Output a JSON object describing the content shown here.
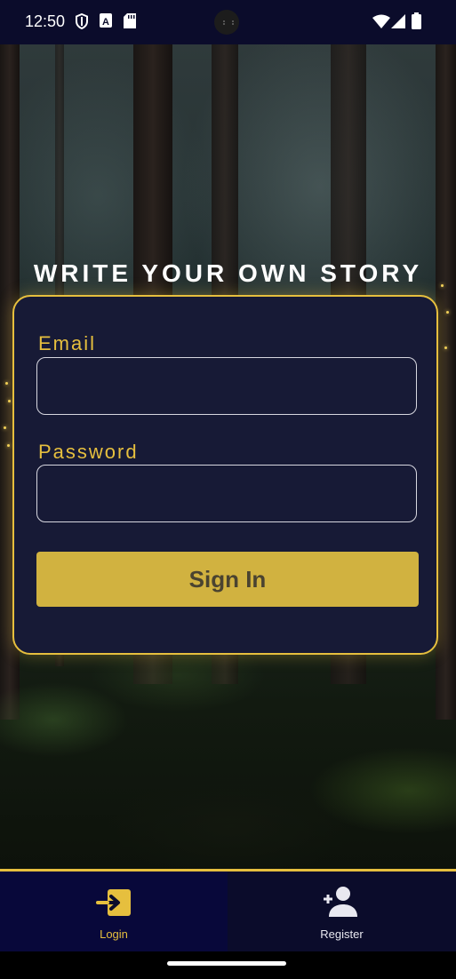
{
  "status_bar": {
    "time": "12:50",
    "left_icons": [
      "shield-icon",
      "a-box-icon",
      "sd-card-icon"
    ],
    "right_icons": [
      "wifi-icon",
      "signal-icon",
      "battery-icon"
    ]
  },
  "headline": "WRITE YOUR OWN STORY",
  "login_form": {
    "email_label": "Email",
    "email_value": "",
    "password_label": "Password",
    "password_value": "",
    "signin_label": "Sign In"
  },
  "bottom_nav": {
    "items": [
      {
        "label": "Login",
        "icon": "login-icon",
        "active": true
      },
      {
        "label": "Register",
        "icon": "add-person-icon",
        "active": false
      }
    ]
  },
  "colors": {
    "accent": "#e6bf3e",
    "card_bg": "#171a36",
    "nav_bg": "#0b0c2b",
    "button_bg": "#d1b240",
    "inactive_nav_text": "#e8e8f0"
  }
}
